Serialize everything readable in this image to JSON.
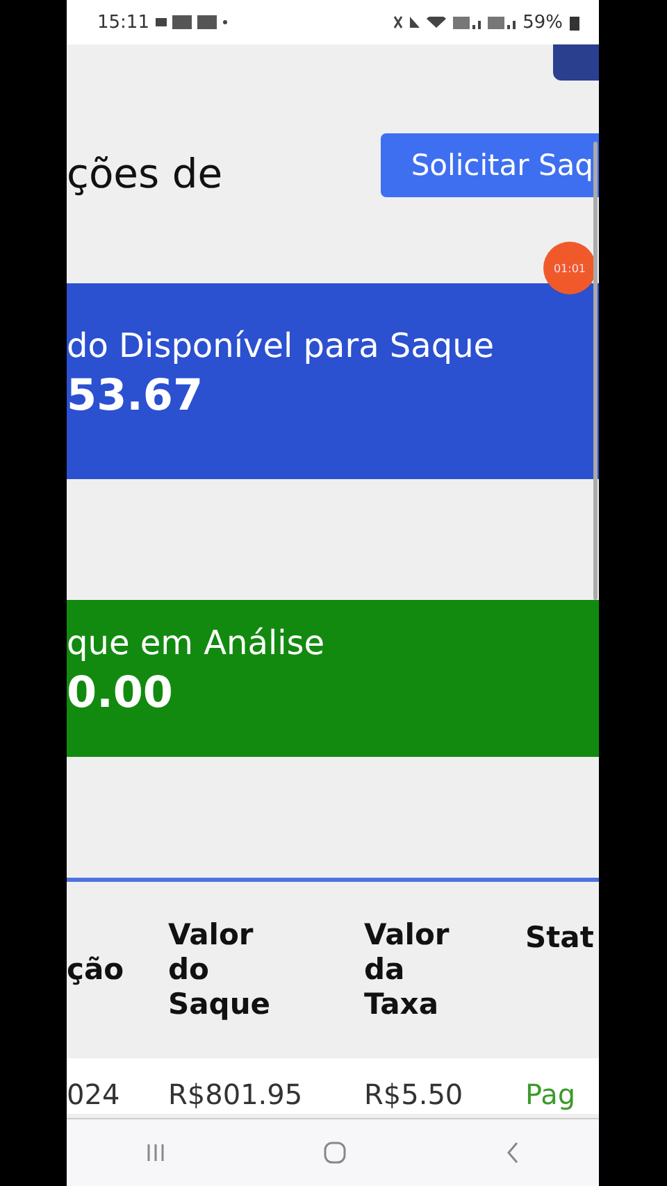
{
  "status_bar": {
    "time": "15:11",
    "battery": "59%"
  },
  "page": {
    "title": "ções de",
    "action_button": "Solicitar Saq",
    "timer": "01:01"
  },
  "cards": [
    {
      "kind": "available",
      "label": "do Disponível para Saque",
      "value": "53.67"
    },
    {
      "kind": "review",
      "label": "que em Análise",
      "value": "0.00"
    }
  ],
  "table": {
    "columns": [
      "ção",
      "Valor do Saque",
      "Valor da Taxa",
      "Stat"
    ],
    "rows": [
      {
        "cells": [
          "024",
          "R$801.95",
          "R$5.50",
          "Pag"
        ],
        "color": "#3d9a2b"
      }
    ]
  }
}
